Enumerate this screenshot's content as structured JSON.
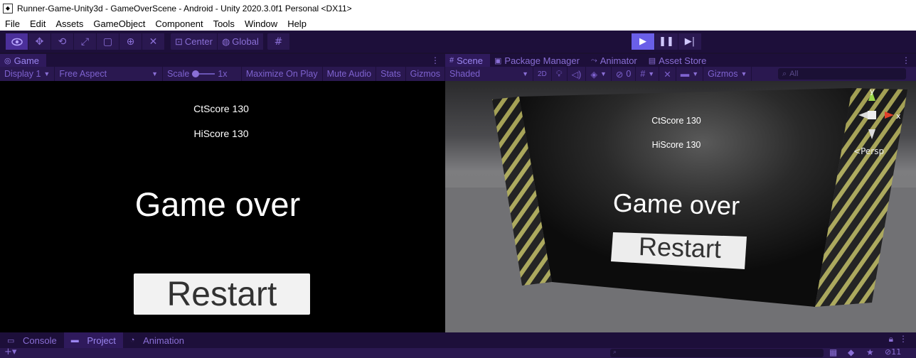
{
  "window": {
    "title": "Runner-Game-Unity3d - GameOverScene - Android - Unity 2020.3.0f1 Personal <DX11>"
  },
  "menu": [
    "File",
    "Edit",
    "Assets",
    "GameObject",
    "Component",
    "Tools",
    "Window",
    "Help"
  ],
  "toolbar": {
    "pivot_label": "Center",
    "space_label": "Global"
  },
  "game_panel": {
    "tab_label": "Game",
    "display_label": "Display 1",
    "aspect_label": "Free Aspect",
    "scale_label": "Scale",
    "scale_value": "1x",
    "maximize_label": "Maximize On Play",
    "mute_label": "Mute Audio",
    "stats_label": "Stats",
    "gizmos_label": "Gizmos"
  },
  "game_ui": {
    "ct_score": "CtScore 130",
    "hi_score": "HiScore 130",
    "game_over": "Game over",
    "restart": "Restart"
  },
  "scene_panel": {
    "tabs": [
      "Scene",
      "Package Manager",
      "Animator",
      "Asset Store"
    ],
    "shading_label": "Shaded",
    "mode_2d_label": "2D",
    "hidden_count": "0",
    "gizmos_label": "Gizmos",
    "search_placeholder": "All",
    "persp_label": "Persp",
    "axis_y": "y",
    "axis_x": "x"
  },
  "bottom_panel": {
    "tabs": [
      "Console",
      "Project",
      "Animation"
    ],
    "badge_count": "11"
  },
  "colors": {
    "editor_bg": "#1d0f3a",
    "accent": "#8a6fd6",
    "play_active": "#6a5fe8"
  }
}
